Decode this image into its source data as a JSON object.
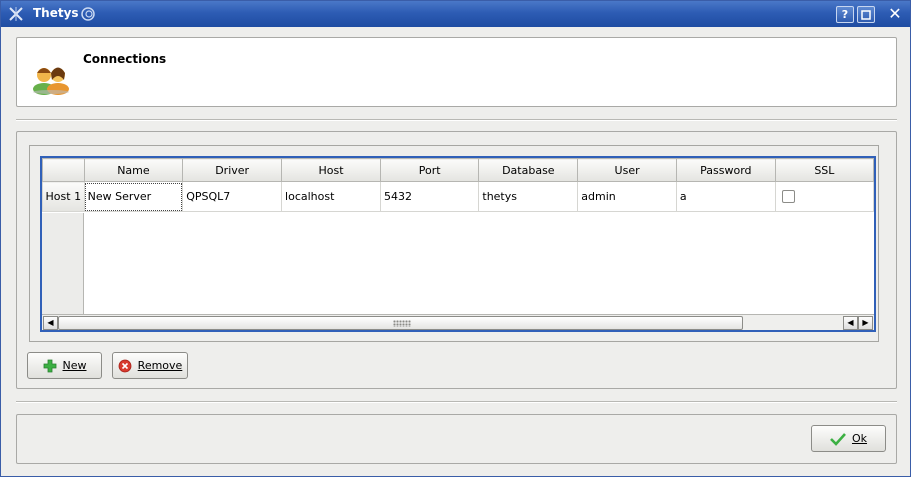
{
  "window": {
    "title": "Thetys",
    "help_btn": "?",
    "max_btn": "□",
    "close_btn": "✕"
  },
  "header": {
    "title": "Connections",
    "icon": "users-icon"
  },
  "table": {
    "columns": [
      "Name",
      "Driver",
      "Host",
      "Port",
      "Database",
      "User",
      "Password",
      "SSL"
    ],
    "rows": [
      {
        "header": "Host 1",
        "name": "New Server",
        "driver": "QPSQL7",
        "host": "localhost",
        "port": "5432",
        "database": "thetys",
        "user": "admin",
        "password": "a",
        "ssl": false
      }
    ]
  },
  "buttons": {
    "new_label": "New",
    "remove_label": "Remove",
    "ok_label": "Ok"
  },
  "colors": {
    "titlebar": "#2d5cb4",
    "table_border": "#3060b8",
    "new_icon": "#3cb043",
    "remove_icon": "#d83a2e",
    "ok_icon": "#3cb043"
  }
}
